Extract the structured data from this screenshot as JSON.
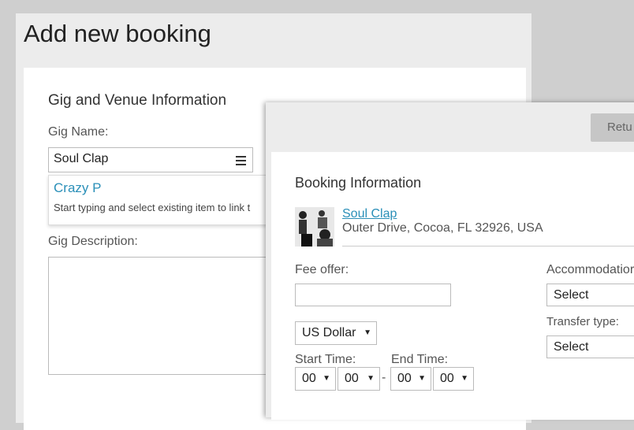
{
  "page": {
    "title": "Add new booking"
  },
  "gig": {
    "section_title": "Gig and Venue Information",
    "name_label": "Gig Name:",
    "name_value": "Soul Clap",
    "suggestion": "Crazy P",
    "hint": "Start typing and select existing item to link t",
    "description_label": "Gig Description:"
  },
  "modal": {
    "return_label": "Retu",
    "section_title": "Booking Information",
    "venue_name": "Soul Clap",
    "venue_address": "Outer Drive, Cocoa, FL 32926, USA",
    "fee_label": "Fee offer:",
    "fee_value": "",
    "currency": "US Dollar",
    "start_label": "Start Time:",
    "end_label": "End Time:",
    "start_hour": "00",
    "start_min": "00",
    "end_hour": "00",
    "end_min": "00",
    "time_sep": "-",
    "accommodation_label": "Accommodatior",
    "accommodation_value": "Select",
    "transfer_label": "Transfer type:",
    "transfer_value": "Select"
  }
}
